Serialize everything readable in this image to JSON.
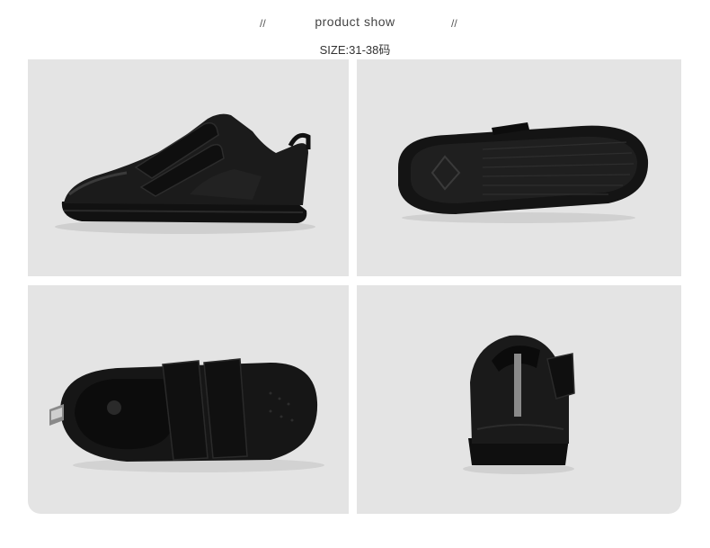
{
  "header": {
    "slash_left": "//",
    "title": "product show",
    "slash_right": "//",
    "size_label": "SIZE:31-38码"
  },
  "gallery": {
    "views": [
      {
        "view": "side"
      },
      {
        "view": "sole"
      },
      {
        "view": "top"
      },
      {
        "view": "back"
      }
    ]
  },
  "colors": {
    "panel_bg": "#e4e4e4",
    "shoe_black": "#151515",
    "reflective_strip": "#8a8a8a"
  }
}
